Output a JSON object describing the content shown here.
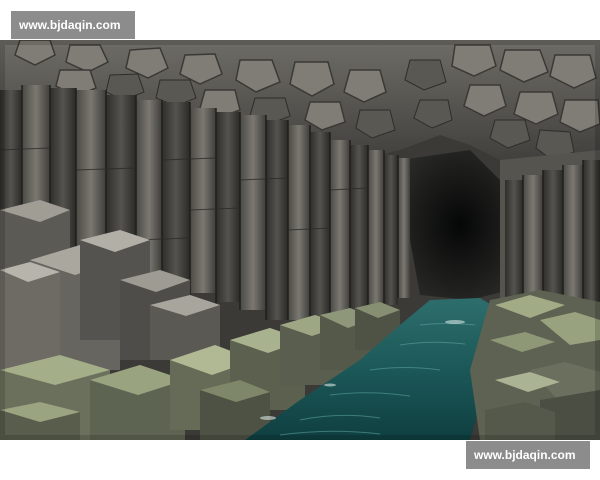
{
  "watermark": {
    "top_text": "www.bjdaqin.com",
    "bottom_text": "www.bjdaqin.com"
  },
  "photo": {
    "subject": "basalt-column-sea-cave",
    "colors": {
      "rock_dark": "#2f2f2d",
      "rock_mid": "#5e5d58",
      "rock_light": "#8d8a82",
      "moss": "#8a9870",
      "water_deep": "#0f3f40",
      "water_light": "#2f7f80",
      "cave_interior": "#111412"
    }
  }
}
